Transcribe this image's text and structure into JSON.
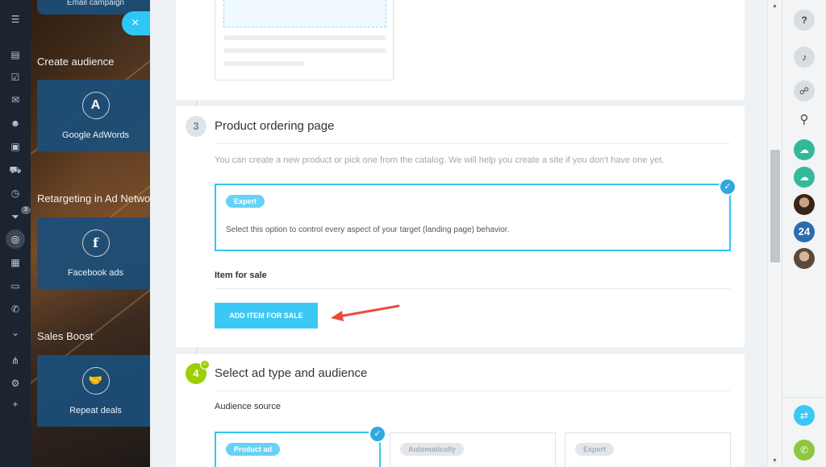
{
  "left_panel": {
    "top_tile_label": "Email campaign",
    "close_symbol": "×",
    "sections": [
      {
        "title": "Create audience",
        "tile_label": "Google AdWords",
        "tile_icon": "adwords-icon",
        "tile_glyph": "A"
      },
      {
        "title": "Retargeting in Ad Netwo",
        "tile_label": "Facebook ads",
        "tile_icon": "facebook-icon",
        "tile_glyph": "f"
      },
      {
        "title": "Sales Boost",
        "tile_label": "Repeat deals",
        "tile_icon": "handshake-icon",
        "tile_glyph": "🤝"
      }
    ],
    "rail_badge": "3"
  },
  "steps": {
    "step3": {
      "number": "3",
      "title": "Product ordering page",
      "description": "You can create a new product or pick one from the catalog. We will help you create a site if you don't have one yet.",
      "option": {
        "tag": "Expert",
        "text": "Select this option to control every aspect of your target (landing page) behavior."
      },
      "item_label": "Item for sale",
      "add_button": "ADD ITEM FOR SALE"
    },
    "step4": {
      "number": "4",
      "title": "Select ad type and audience",
      "audience_label": "Audience source",
      "options": [
        {
          "tag": "Product ad",
          "selected": true
        },
        {
          "tag": "Automatically",
          "selected": false
        },
        {
          "tag": "Expert",
          "selected": false
        }
      ]
    }
  },
  "right_rail": {
    "badge_24": "24",
    "icons": [
      "help-icon",
      "bell-icon",
      "chat-search-icon",
      "search-icon",
      "cloud-icon",
      "cloud-icon",
      "avatar",
      "bitrix24-icon",
      "avatar",
      "phone-transfer-icon",
      "phone-icon"
    ]
  },
  "colors": {
    "accent": "#2fc6f6",
    "done": "#9dcf00",
    "arrow": "#e74c3c"
  }
}
